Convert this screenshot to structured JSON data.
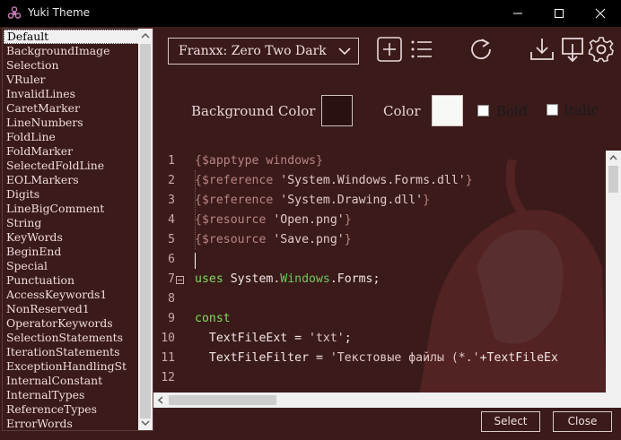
{
  "window": {
    "title": "Yuki Theme"
  },
  "element_list": {
    "selected_index": 0,
    "items": [
      "Default",
      "BackgroundImage",
      "Selection",
      "VRuler",
      "InvalidLines",
      "CaretMarker",
      "LineNumbers",
      "FoldLine",
      "FoldMarker",
      "SelectedFoldLine",
      "EOLMarkers",
      "Digits",
      "LineBigComment",
      "String",
      "KeyWords",
      "BeginEnd",
      "Special",
      "Punctuation",
      "AccessKeywords1",
      "NonReserved1",
      "OperatorKeywords",
      "SelectionStatements",
      "IterationStatements",
      "ExceptionHandlingSt",
      "InternalConstant",
      "InternalTypes",
      "ReferenceTypes",
      "ErrorWords"
    ]
  },
  "toolbar": {
    "theme_selected": "Franxx: Zero Two Dark",
    "icons": [
      "add-icon",
      "list-icon",
      "refresh-icon",
      "download-icon",
      "export-icon",
      "gear-icon"
    ]
  },
  "style_panel": {
    "background_label": "Background Color",
    "background_color": "#2a1010",
    "color_label": "Color",
    "color_value": "#f8f8f4",
    "bold_label": "Bold",
    "italic_label": "Italic"
  },
  "editor": {
    "line_numbers": [
      "1",
      "2",
      "3",
      "4",
      "5",
      "6",
      "7",
      "8",
      "9",
      "10",
      "11",
      "12"
    ],
    "lines": [
      [
        {
          "t": "{$apptype windows}",
          "c": "c-brace"
        }
      ],
      [
        {
          "t": "{$reference ",
          "c": "c-brace"
        },
        {
          "t": "'System.Windows.Forms.dll'",
          "c": "c-str"
        },
        {
          "t": "}",
          "c": "c-brace"
        }
      ],
      [
        {
          "t": "{$reference ",
          "c": "c-brace"
        },
        {
          "t": "'System.Drawing.dll'",
          "c": "c-str"
        },
        {
          "t": "}",
          "c": "c-brace"
        }
      ],
      [
        {
          "t": "{$resource ",
          "c": "c-brace"
        },
        {
          "t": "'Open.png'",
          "c": "c-str"
        },
        {
          "t": "}",
          "c": "c-brace"
        }
      ],
      [
        {
          "t": "{$resource ",
          "c": "c-brace"
        },
        {
          "t": "'Save.png'",
          "c": "c-str"
        },
        {
          "t": "}",
          "c": "c-brace"
        }
      ],
      [],
      [
        {
          "t": "uses ",
          "c": "c-kw"
        },
        {
          "t": "System.",
          "c": "c-id"
        },
        {
          "t": "Windows",
          "c": "c-green"
        },
        {
          "t": ".Forms;",
          "c": "c-id"
        }
      ],
      [],
      [
        {
          "t": "const",
          "c": "c-kw"
        }
      ],
      [
        {
          "t": "  TextFileExt = ",
          "c": "c-id"
        },
        {
          "t": "'txt'",
          "c": "c-str"
        },
        {
          "t": ";",
          "c": "c-id"
        }
      ],
      [
        {
          "t": "  TextFileFilter = ",
          "c": "c-id"
        },
        {
          "t": "'Текстовые файлы (*.'",
          "c": "c-str"
        },
        {
          "t": "+TextFileEx",
          "c": "c-id"
        }
      ],
      []
    ]
  },
  "buttons": {
    "select": "Select",
    "close": "Close"
  }
}
